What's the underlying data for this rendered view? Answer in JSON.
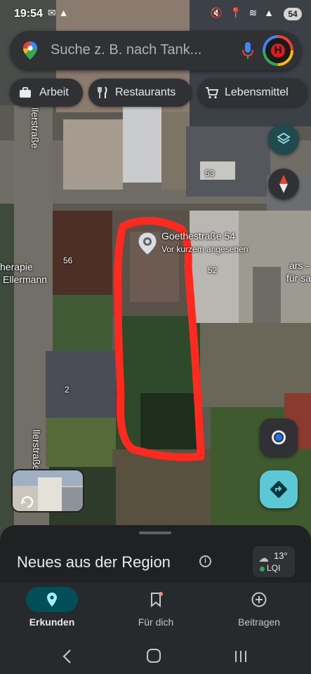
{
  "status_bar": {
    "time": "19:54",
    "left_icons": "✉ ▲",
    "right_icons": "🔇 📍 ≋ ▲",
    "battery": "54"
  },
  "search": {
    "placeholder": "Suche z. B. nach Tank...",
    "icon": "maps-pin-icon",
    "mic_icon": "mic-icon",
    "avatar_letter": "H"
  },
  "chips": [
    {
      "label": "Arbeit",
      "icon": "briefcase-icon"
    },
    {
      "label": "Restaurants",
      "icon": "fork-knife-icon"
    },
    {
      "label": "Lebensmittel",
      "icon": "cart-icon"
    }
  ],
  "map": {
    "place": {
      "name": "Goethestraße 54",
      "subtitle": "Vor kurzem angesehen"
    },
    "labels": {
      "house_53": "53",
      "house_56": "56",
      "house_52": "52",
      "house_2": "2",
      "therapy_line1": "herapie",
      "therapy_line2": "Ellermann",
      "right_line1": "ars -",
      "right_line2": "für sa"
    },
    "streets": {
      "top": "illerstraße",
      "bottom": "llerstraße"
    },
    "highlight_color": "#ff2a1f"
  },
  "sheet": {
    "title": "Neues aus der Region",
    "info_icon": "info-icon",
    "weather": {
      "temp": "13°",
      "lqi": "LQI",
      "icon": "cloud-rain-icon"
    }
  },
  "nav": {
    "items": [
      {
        "label": "Erkunden",
        "icon": "location-pin-icon",
        "active": true
      },
      {
        "label": "Für dich",
        "icon": "bookmark-icon",
        "active": false
      },
      {
        "label": "Beitragen",
        "icon": "add-circle-icon",
        "active": false
      }
    ]
  },
  "colors": {
    "accent_teal": "#5cc8d6",
    "active_pill": "#004f58",
    "red_scribble": "#ff2a1f",
    "location_blue": "#1a73e8"
  }
}
